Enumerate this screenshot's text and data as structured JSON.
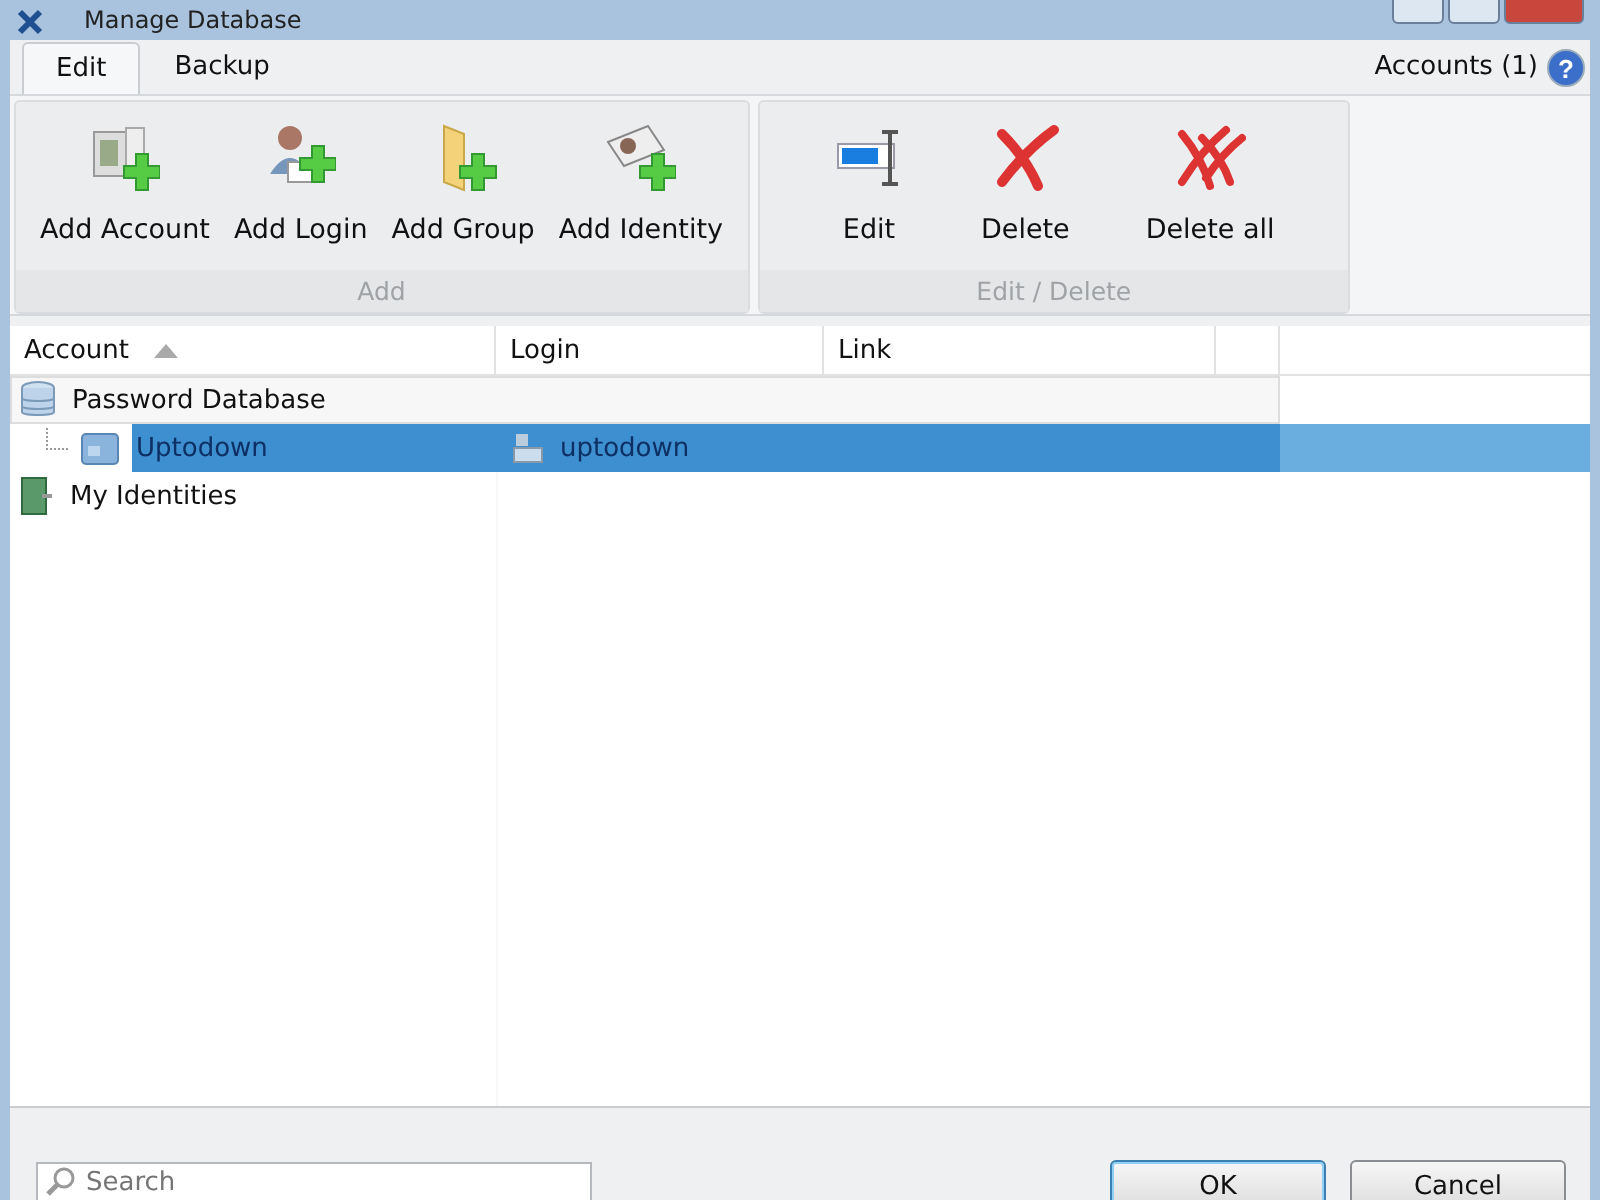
{
  "window": {
    "title": "Manage Database"
  },
  "tabs": [
    {
      "label": "Edit",
      "selected": true
    },
    {
      "label": "Backup",
      "selected": false
    }
  ],
  "accounts_count": "Accounts (1)",
  "help_button": "?",
  "ribbon_groups": [
    {
      "label": "Add",
      "buttons": [
        {
          "kind": "add-account",
          "label": "Add Account"
        },
        {
          "kind": "add-login",
          "label": "Add Login"
        },
        {
          "kind": "add-group",
          "label": "Add Group"
        },
        {
          "kind": "add-identity",
          "label": "Add Identity"
        }
      ]
    },
    {
      "label": "Edit / Delete",
      "buttons": [
        {
          "kind": "edit",
          "label": "Edit"
        },
        {
          "kind": "delete",
          "label": "Delete"
        },
        {
          "kind": "delete-all",
          "label": "Delete all"
        }
      ]
    }
  ],
  "table": {
    "columns": [
      {
        "label": "Account",
        "sorted": true
      },
      {
        "label": "Login",
        "sorted": false
      },
      {
        "label": "Link",
        "sorted": false
      }
    ],
    "rows": [
      {
        "kind": "database",
        "account": "Password Database",
        "selected": false,
        "children": [
          {
            "kind": "account",
            "account": "Uptodown",
            "login": "uptodown",
            "selected": true
          }
        ]
      },
      {
        "kind": "identities",
        "account": "My Identities",
        "selected": false
      }
    ]
  },
  "search": {
    "placeholder": "Search"
  },
  "buttons": [
    {
      "label": "OK",
      "default": true
    },
    {
      "label": "Cancel",
      "default": false
    }
  ]
}
